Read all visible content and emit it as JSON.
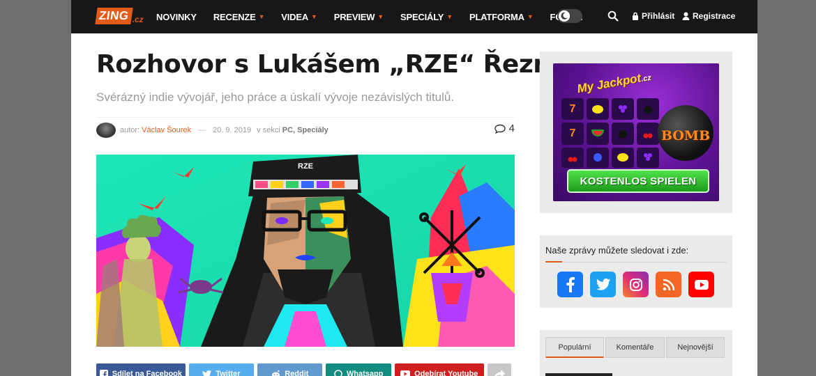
{
  "header": {
    "logo_main": "ZING",
    "logo_suffix": ".cz",
    "nav": [
      {
        "label": "NOVINKY",
        "has_dropdown": false
      },
      {
        "label": "RECENZE",
        "has_dropdown": true
      },
      {
        "label": "VIDEA",
        "has_dropdown": true
      },
      {
        "label": "PREVIEW",
        "has_dropdown": true
      },
      {
        "label": "SPECIÁLY",
        "has_dropdown": true
      },
      {
        "label": "PLATFORMA",
        "has_dropdown": true
      },
      {
        "label": "FÓRUM",
        "has_dropdown": false
      }
    ],
    "login_label": "Přihlásit",
    "register_label": "Registrace"
  },
  "article": {
    "title": "Rozhovor s Lukášem „RZE“ Řezníčkem",
    "subtitle": "Svérázný indie vývojář, jeho práce a úskalí vývoje nezávislých titulů.",
    "author_prefix": "autor:",
    "author": "Václav Šourek",
    "date": "20. 9. 2019",
    "section_prefix": "v sekci",
    "sections": "PC, Speciály",
    "comment_count": "4",
    "hero_hat_text": "RZE"
  },
  "share": [
    {
      "label": "Sdílet na Facebook",
      "color": "#3b5998",
      "icon": "facebook-icon"
    },
    {
      "label": "Twitter",
      "color": "#55acee",
      "icon": "twitter-icon"
    },
    {
      "label": "Reddit",
      "color": "#5f99cf",
      "icon": "reddit-icon"
    },
    {
      "label": "Whatsapp",
      "color": "#128c7e",
      "icon": "whatsapp-icon"
    },
    {
      "label": "Odebírat Youtube",
      "color": "#cd201f",
      "icon": "youtube-icon"
    },
    {
      "label": "",
      "color": "#c8c8c8",
      "icon": "share-icon"
    }
  ],
  "sidebar": {
    "ad": {
      "brand": "My Jackpot",
      "brand_suffix": ".cz",
      "bomb_text": "BOMB",
      "cta": "KOSTENLOS SPIELEN"
    },
    "follow_title": "Naše zprávy můžete sledovat i zde:",
    "socials": [
      {
        "name": "facebook",
        "color": "#1877f2"
      },
      {
        "name": "twitter",
        "color": "#1da1f2"
      },
      {
        "name": "instagram",
        "color": "#c13584"
      },
      {
        "name": "rss",
        "color": "#f26522"
      },
      {
        "name": "youtube",
        "color": "#ff0000"
      }
    ],
    "tabs": [
      "Populární",
      "Komentáře",
      "Nejnovější"
    ],
    "active_tab": "Populární"
  },
  "colors": {
    "accent": "#e25b17",
    "header_bg": "#17171a"
  }
}
